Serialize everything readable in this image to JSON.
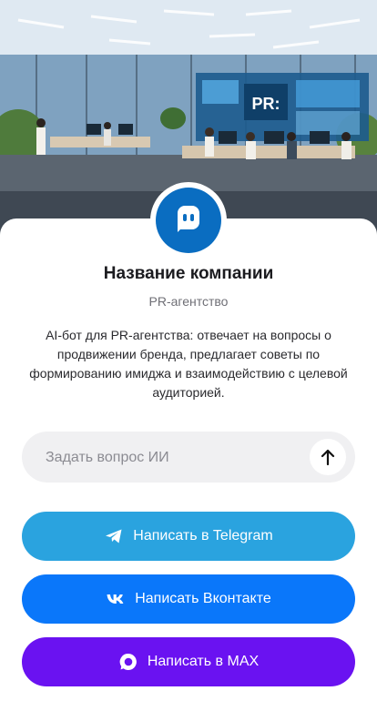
{
  "company": {
    "name": "Название компании",
    "type": "PR-агентство",
    "description": "AI-бот для PR-агентства: отвечает на вопросы о продвижении бренда, предлагает советы по формированию имиджа и взаимодействию с целевой аудиторией."
  },
  "hero": {
    "screen_text": "PR:"
  },
  "ask": {
    "placeholder": "Задать вопрос ИИ"
  },
  "buttons": {
    "telegram": "Написать в Telegram",
    "vk": "Написать Вконтакте",
    "max": "Написать в MAX"
  },
  "colors": {
    "avatar": "#0a6dc1",
    "telegram": "#2aa3df",
    "vk": "#0a77fa",
    "max": "#6a12f1"
  },
  "icons": [
    "chat-bot-icon",
    "arrow-up-icon",
    "telegram-icon",
    "vk-icon",
    "max-icon"
  ]
}
